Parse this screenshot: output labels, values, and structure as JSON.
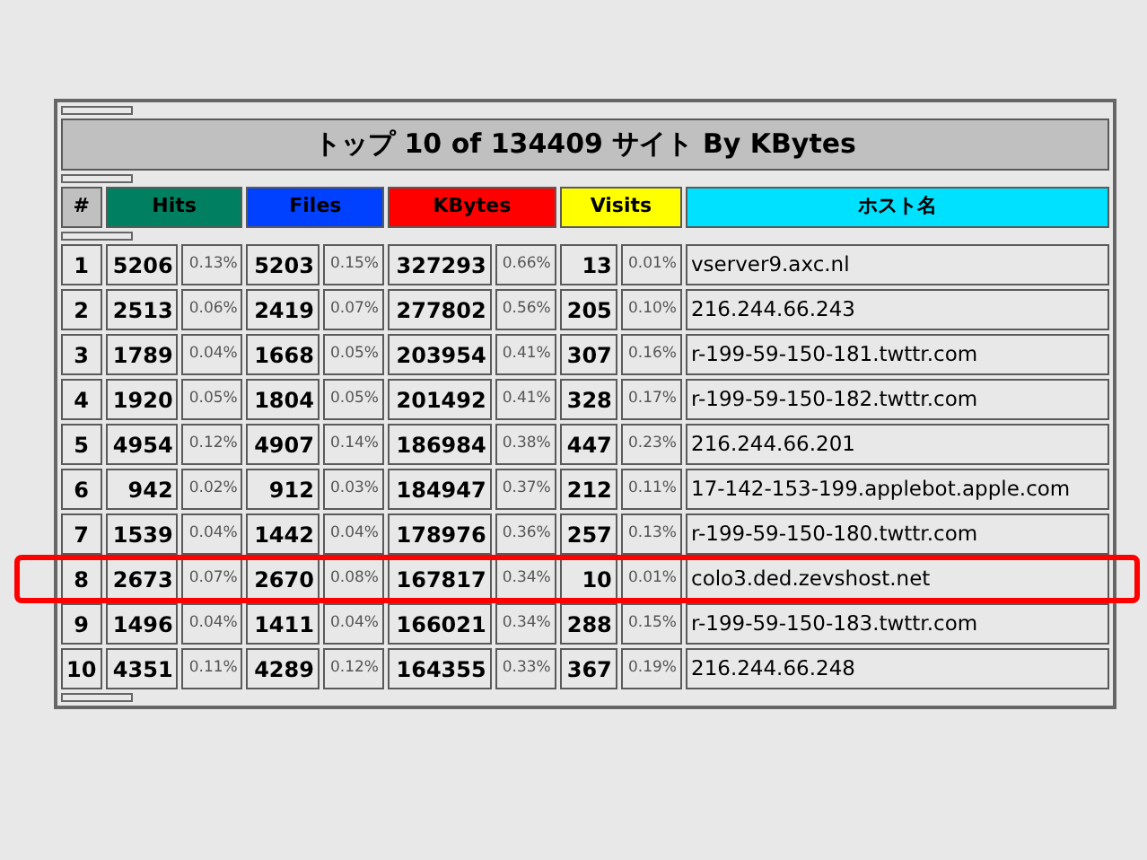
{
  "title": "トップ 10 of 134409 サイト By KBytes",
  "columns": [
    {
      "label": "#",
      "color": "#c0c0c0"
    },
    {
      "label": "Hits",
      "color": "#008060"
    },
    {
      "label": "Files",
      "color": "#0040ff"
    },
    {
      "label": "KBytes",
      "color": "#ff0000"
    },
    {
      "label": "Visits",
      "color": "#ffff00"
    },
    {
      "label": "ホスト名",
      "color": "#00e0ff"
    }
  ],
  "rows": [
    {
      "rank": "1",
      "hits": "5206",
      "hits_pct": "0.13%",
      "files": "5203",
      "files_pct": "0.15%",
      "kbytes": "327293",
      "kbytes_pct": "0.66%",
      "visits": "13",
      "visits_pct": "0.01%",
      "host": "vserver9.axc.nl",
      "highlighted": false
    },
    {
      "rank": "2",
      "hits": "2513",
      "hits_pct": "0.06%",
      "files": "2419",
      "files_pct": "0.07%",
      "kbytes": "277802",
      "kbytes_pct": "0.56%",
      "visits": "205",
      "visits_pct": "0.10%",
      "host": "216.244.66.243",
      "highlighted": false
    },
    {
      "rank": "3",
      "hits": "1789",
      "hits_pct": "0.04%",
      "files": "1668",
      "files_pct": "0.05%",
      "kbytes": "203954",
      "kbytes_pct": "0.41%",
      "visits": "307",
      "visits_pct": "0.16%",
      "host": "r-199-59-150-181.twttr.com",
      "highlighted": false
    },
    {
      "rank": "4",
      "hits": "1920",
      "hits_pct": "0.05%",
      "files": "1804",
      "files_pct": "0.05%",
      "kbytes": "201492",
      "kbytes_pct": "0.41%",
      "visits": "328",
      "visits_pct": "0.17%",
      "host": "r-199-59-150-182.twttr.com",
      "highlighted": false
    },
    {
      "rank": "5",
      "hits": "4954",
      "hits_pct": "0.12%",
      "files": "4907",
      "files_pct": "0.14%",
      "kbytes": "186984",
      "kbytes_pct": "0.38%",
      "visits": "447",
      "visits_pct": "0.23%",
      "host": "216.244.66.201",
      "highlighted": false
    },
    {
      "rank": "6",
      "hits": "942",
      "hits_pct": "0.02%",
      "files": "912",
      "files_pct": "0.03%",
      "kbytes": "184947",
      "kbytes_pct": "0.37%",
      "visits": "212",
      "visits_pct": "0.11%",
      "host": "17-142-153-199.applebot.apple.com",
      "highlighted": false
    },
    {
      "rank": "7",
      "hits": "1539",
      "hits_pct": "0.04%",
      "files": "1442",
      "files_pct": "0.04%",
      "kbytes": "178976",
      "kbytes_pct": "0.36%",
      "visits": "257",
      "visits_pct": "0.13%",
      "host": "r-199-59-150-180.twttr.com",
      "highlighted": false
    },
    {
      "rank": "8",
      "hits": "2673",
      "hits_pct": "0.07%",
      "files": "2670",
      "files_pct": "0.08%",
      "kbytes": "167817",
      "kbytes_pct": "0.34%",
      "visits": "10",
      "visits_pct": "0.01%",
      "host": "colo3.ded.zevshost.net",
      "highlighted": true
    },
    {
      "rank": "9",
      "hits": "1496",
      "hits_pct": "0.04%",
      "files": "1411",
      "files_pct": "0.04%",
      "kbytes": "166021",
      "kbytes_pct": "0.34%",
      "visits": "288",
      "visits_pct": "0.15%",
      "host": "r-199-59-150-183.twttr.com",
      "highlighted": false
    },
    {
      "rank": "10",
      "hits": "4351",
      "hits_pct": "0.11%",
      "files": "4289",
      "files_pct": "0.12%",
      "kbytes": "164355",
      "kbytes_pct": "0.33%",
      "visits": "367",
      "visits_pct": "0.19%",
      "host": "216.244.66.248",
      "highlighted": false
    }
  ]
}
